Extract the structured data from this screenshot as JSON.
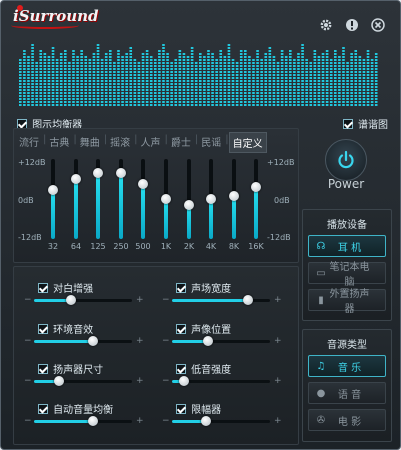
{
  "app": {
    "logo_text": "iSurround"
  },
  "titlebar": {
    "settings_icon": "gear-icon",
    "info_icon": "info-icon",
    "close_icon": "close-icon"
  },
  "spectrum": {
    "visible": true,
    "levels": [
      0.72,
      0.9,
      0.8,
      0.95,
      0.7,
      0.88,
      0.85,
      0.8,
      0.92,
      0.76,
      0.84,
      0.9,
      0.7,
      0.86,
      0.78,
      0.9,
      0.8,
      0.72,
      0.85,
      0.95,
      0.74,
      0.82,
      0.88,
      0.7,
      0.9,
      0.8,
      0.84,
      0.92,
      0.76,
      0.68,
      0.85,
      0.9,
      0.8,
      0.72,
      0.88,
      0.95,
      0.82,
      0.7,
      0.76,
      0.9,
      0.84,
      0.8,
      0.93,
      0.7,
      0.85,
      0.78,
      0.9,
      0.82,
      0.74,
      0.88,
      0.8,
      0.95,
      0.76,
      0.7,
      0.86,
      0.9,
      0.8,
      0.75,
      0.88,
      0.72,
      0.84,
      0.92,
      0.78,
      0.7,
      0.86,
      0.8,
      0.9,
      0.74,
      0.82,
      0.95,
      0.76,
      0.7,
      0.88,
      0.8,
      0.84,
      0.9,
      0.72,
      0.86,
      0.78,
      0.92,
      0.7,
      0.84,
      0.88,
      0.8,
      0.76,
      0.9,
      0.74,
      0.82
    ]
  },
  "equalizer_toggle": {
    "label": "图示均衡器",
    "checked": true
  },
  "spectrum_toggle": {
    "label": "谱谐图",
    "checked": true
  },
  "equalizer": {
    "presets": [
      "流行",
      "古典",
      "舞曲",
      "摇滚",
      "人声",
      "爵士",
      "民谣",
      "自定义"
    ],
    "selected_preset": "自定义",
    "db_top": "+12dB",
    "db_mid": "0dB",
    "db_bottom": "-12dB",
    "bands": [
      {
        "freq": "32",
        "gain": 3
      },
      {
        "freq": "64",
        "gain": 7
      },
      {
        "freq": "125",
        "gain": 9
      },
      {
        "freq": "250",
        "gain": 9
      },
      {
        "freq": "500",
        "gain": 5
      },
      {
        "freq": "1K",
        "gain": 0
      },
      {
        "freq": "2K",
        "gain": -2
      },
      {
        "freq": "4K",
        "gain": 0
      },
      {
        "freq": "8K",
        "gain": 1
      },
      {
        "freq": "16K",
        "gain": 4
      }
    ]
  },
  "power": {
    "label": "Power",
    "icon": "power-icon",
    "accent": "#39d6ee"
  },
  "playback_device": {
    "title": "播放设备",
    "options": [
      {
        "label": "耳  机",
        "icon": "headphones-icon",
        "active": true
      },
      {
        "label": "笔记本电脑",
        "icon": "laptop-icon",
        "active": false
      },
      {
        "label": "外置扬声器",
        "icon": "speaker-icon",
        "active": false
      }
    ]
  },
  "source_type": {
    "title": "音源类型",
    "options": [
      {
        "label": "音  乐",
        "icon": "music-icon",
        "active": true
      },
      {
        "label": "语  音",
        "icon": "voice-icon",
        "active": false
      },
      {
        "label": "电  影",
        "icon": "film-icon",
        "active": false
      }
    ]
  },
  "effects": [
    {
      "label": "对白增强",
      "checked": true,
      "value": 0.38
    },
    {
      "label": "声场宽度",
      "checked": true,
      "value": 0.78
    },
    {
      "label": "环境音效",
      "checked": true,
      "value": 0.6
    },
    {
      "label": "声像位置",
      "checked": true,
      "value": 0.37
    },
    {
      "label": "扬声器尺寸",
      "checked": true,
      "value": 0.26
    },
    {
      "label": "低音强度",
      "checked": true,
      "value": 0.12
    },
    {
      "label": "自动音量均衡",
      "checked": true,
      "value": 0.6
    },
    {
      "label": "限幅器",
      "checked": true,
      "value": 0.35
    }
  ],
  "colors": {
    "accent": "#27e0f0",
    "panel": "#1f2429"
  }
}
